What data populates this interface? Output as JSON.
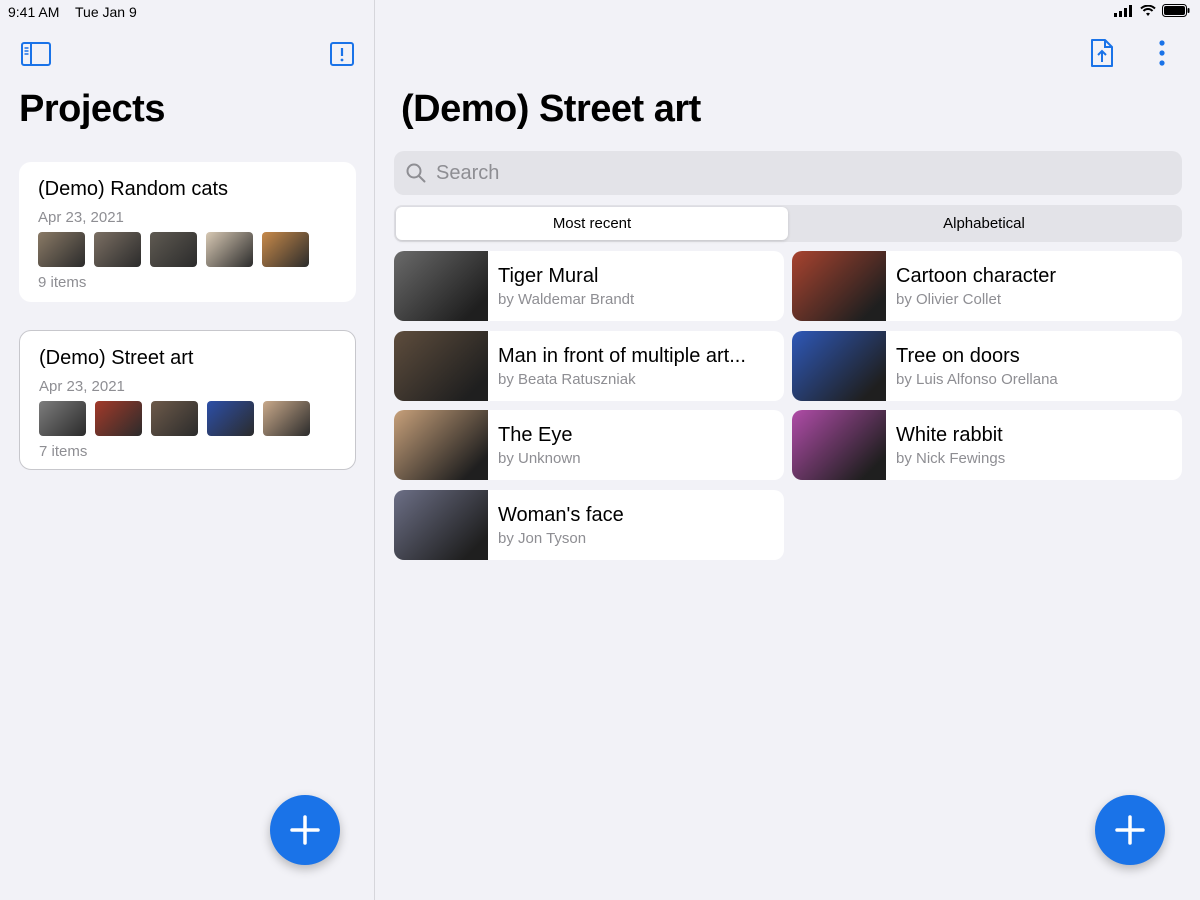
{
  "status": {
    "time": "9:41 AM",
    "date": "Tue Jan 9"
  },
  "sidebar": {
    "title": "Projects",
    "projects": [
      {
        "name": "(Demo) Random cats",
        "date": "Apr 23, 2021",
        "count": "9 items",
        "thumb_colors": [
          "#8a7a66",
          "#7b6f63",
          "#5f5a52",
          "#d8c9b4",
          "#c88a4a"
        ]
      },
      {
        "name": "(Demo) Street art",
        "date": "Apr 23, 2021",
        "count": "7 items",
        "thumb_colors": [
          "#7d7d7d",
          "#a33a2a",
          "#6d5a4a",
          "#2c4fa8",
          "#c9a98a"
        ]
      }
    ]
  },
  "main": {
    "title": "(Demo) Street art",
    "search": {
      "placeholder": "Search"
    },
    "segments": [
      "Most recent",
      "Alphabetical"
    ],
    "items": [
      {
        "title": "Tiger Mural",
        "author": "by Waldemar Brandt",
        "color": "#6a6a6a"
      },
      {
        "title": "Cartoon character",
        "author": "by Olivier Collet",
        "color": "#a8432f"
      },
      {
        "title": "Man in front of multiple art...",
        "author": "by Beata Ratuszniak",
        "color": "#5e4d3d"
      },
      {
        "title": "Tree on doors",
        "author": "by Luis Alfonso Orellana",
        "color": "#2e58b8"
      },
      {
        "title": "The Eye",
        "author": "by Unknown",
        "color": "#c7a07a"
      },
      {
        "title": "White rabbit",
        "author": "by Nick Fewings",
        "color": "#b04ca8"
      },
      {
        "title": "Woman's face",
        "author": "by Jon Tyson",
        "color": "#6c6f86"
      }
    ]
  },
  "colors": {
    "accent": "#1a73e8",
    "icon": "#1a73e8"
  }
}
